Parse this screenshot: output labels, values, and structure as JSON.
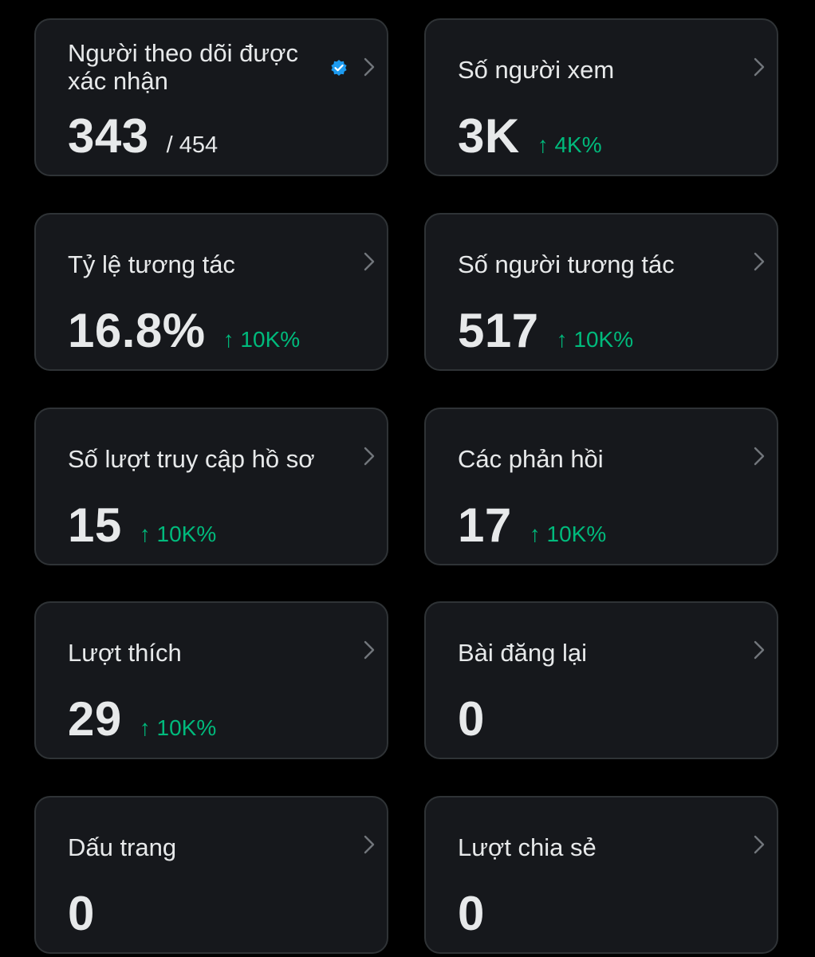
{
  "cards": [
    {
      "label": "Người theo dõi được xác nhận",
      "value": "343",
      "secondary": "/ 454",
      "change": ""
    },
    {
      "label": "Số người xem",
      "value": "3K",
      "change": "↑ 4K%"
    },
    {
      "label": "Tỷ lệ tương tác",
      "value": "16.8%",
      "change": "↑ 10K%"
    },
    {
      "label": "Số người tương tác",
      "value": "517",
      "change": "↑ 10K%"
    },
    {
      "label": "Số lượt truy cập hồ sơ",
      "value": "15",
      "change": "↑ 10K%"
    },
    {
      "label": "Các phản hồi",
      "value": "17",
      "change": "↑ 10K%"
    },
    {
      "label": "Lượt thích",
      "value": "29",
      "change": "↑ 10K%"
    },
    {
      "label": "Bài đăng lại",
      "value": "0",
      "change": ""
    },
    {
      "label": "Dấu trang",
      "value": "0",
      "change": ""
    },
    {
      "label": "Lượt chia sẻ",
      "value": "0",
      "change": ""
    }
  ],
  "icons": {
    "verified": "verified-badge-icon",
    "chevron": "chevron-right-icon"
  },
  "colors": {
    "background": "#000000",
    "card": "#16181c",
    "border": "#2f3336",
    "positive": "#00ba7c",
    "verified": "#1d9bf0",
    "chevron": "#71767b"
  }
}
